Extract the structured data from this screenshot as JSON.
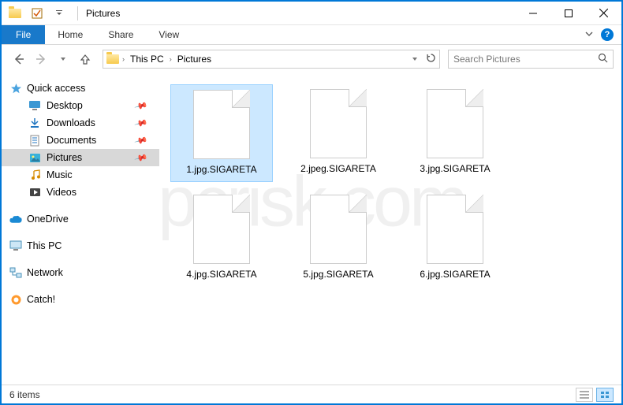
{
  "window": {
    "title": "Pictures"
  },
  "ribbon": {
    "file": "File",
    "tabs": [
      "Home",
      "Share",
      "View"
    ]
  },
  "breadcrumb": {
    "segments": [
      "This PC",
      "Pictures"
    ]
  },
  "search": {
    "placeholder": "Search Pictures"
  },
  "sidebar": {
    "quick_access": {
      "label": "Quick access",
      "items": [
        {
          "label": "Desktop",
          "pinned": true,
          "icon": "desktop"
        },
        {
          "label": "Downloads",
          "pinned": true,
          "icon": "downloads"
        },
        {
          "label": "Documents",
          "pinned": true,
          "icon": "documents"
        },
        {
          "label": "Pictures",
          "pinned": true,
          "icon": "pictures",
          "selected": true
        },
        {
          "label": "Music",
          "pinned": false,
          "icon": "music"
        },
        {
          "label": "Videos",
          "pinned": false,
          "icon": "videos"
        }
      ]
    },
    "roots": [
      {
        "label": "OneDrive",
        "icon": "onedrive"
      },
      {
        "label": "This PC",
        "icon": "thispc"
      },
      {
        "label": "Network",
        "icon": "network"
      },
      {
        "label": "Catch!",
        "icon": "catch"
      }
    ]
  },
  "files": [
    {
      "name": "1.jpg.SIGARETA",
      "selected": true
    },
    {
      "name": "2.jpeg.SIGARETA",
      "selected": false
    },
    {
      "name": "3.jpg.SIGARETA",
      "selected": false
    },
    {
      "name": "4.jpg.SIGARETA",
      "selected": false
    },
    {
      "name": "5.jpg.SIGARETA",
      "selected": false
    },
    {
      "name": "6.jpg.SIGARETA",
      "selected": false
    }
  ],
  "status": {
    "item_count_label": "6 items"
  },
  "watermark": "pcrisk.com"
}
